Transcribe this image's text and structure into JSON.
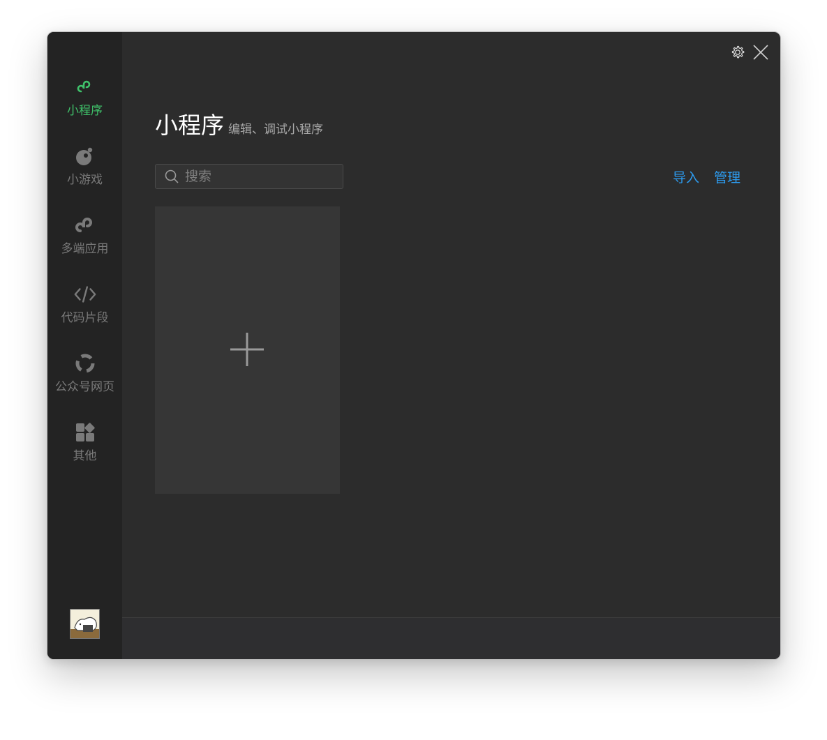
{
  "sidebar": {
    "items": [
      {
        "label": "小程序",
        "icon": "miniprogram-icon",
        "active": true
      },
      {
        "label": "小游戏",
        "icon": "minigame-icon",
        "active": false
      },
      {
        "label": "多端应用",
        "icon": "multiplatform-icon",
        "active": false
      },
      {
        "label": "代码片段",
        "icon": "code-icon",
        "active": false
      },
      {
        "label": "公众号网页",
        "icon": "webpage-icon",
        "active": false
      },
      {
        "label": "其他",
        "icon": "grid-icon",
        "active": false
      }
    ]
  },
  "header": {
    "title": "小程序",
    "subtitle": "编辑、调试小程序"
  },
  "search": {
    "placeholder": "搜索",
    "value": ""
  },
  "actions": {
    "import_label": "导入",
    "manage_label": "管理"
  },
  "colors": {
    "accent_green": "#3fc16a",
    "link_blue": "#2d9cf0",
    "background": "#2c2c2c",
    "sidebar": "#232323"
  }
}
